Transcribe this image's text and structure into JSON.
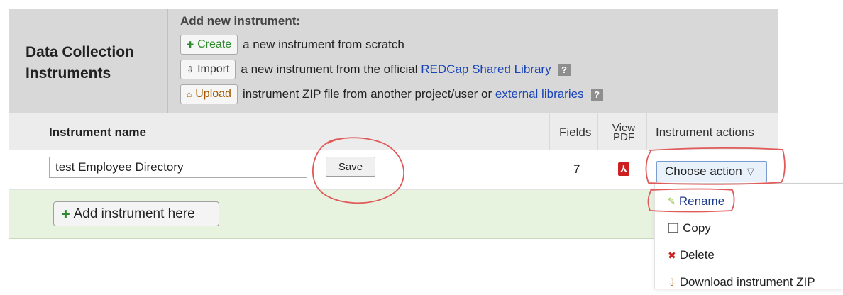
{
  "header": {
    "section_title": "Data Collection Instruments",
    "add_heading": "Add new instrument:",
    "create": {
      "label": "Create",
      "text": "a new instrument from scratch"
    },
    "import": {
      "label": "Import",
      "text": "a new instrument from the official",
      "link": "REDCap Shared Library"
    },
    "upload": {
      "label": "Upload",
      "text": "instrument ZIP file from another project/user or",
      "link": "external libraries"
    },
    "help_glyph": "?"
  },
  "table": {
    "columns": {
      "name": "Instrument name",
      "fields": "Fields",
      "pdf_line1": "View",
      "pdf_line2": "PDF",
      "actions": "Instrument actions"
    },
    "row": {
      "name_value": "test Employee Directory",
      "save_label": "Save",
      "fields": "7",
      "choose_action": "Choose action"
    },
    "add_here_label": "Add instrument here"
  },
  "dropdown": {
    "items": [
      "Rename",
      "Copy",
      "Delete",
      "Download instrument ZIP"
    ]
  },
  "colors": {
    "header_bg": "#d8d8d8",
    "add_row_bg": "#e7f2df",
    "link": "#1a45b8",
    "annotation": "#e05a5a"
  },
  "icons": {
    "create": "plus-icon",
    "import": "import-icon",
    "upload": "upload-icon",
    "pdf": "pdf-icon",
    "rename": "pencil-icon",
    "copy": "copy-icon",
    "delete": "delete-icon",
    "download": "download-icon"
  }
}
